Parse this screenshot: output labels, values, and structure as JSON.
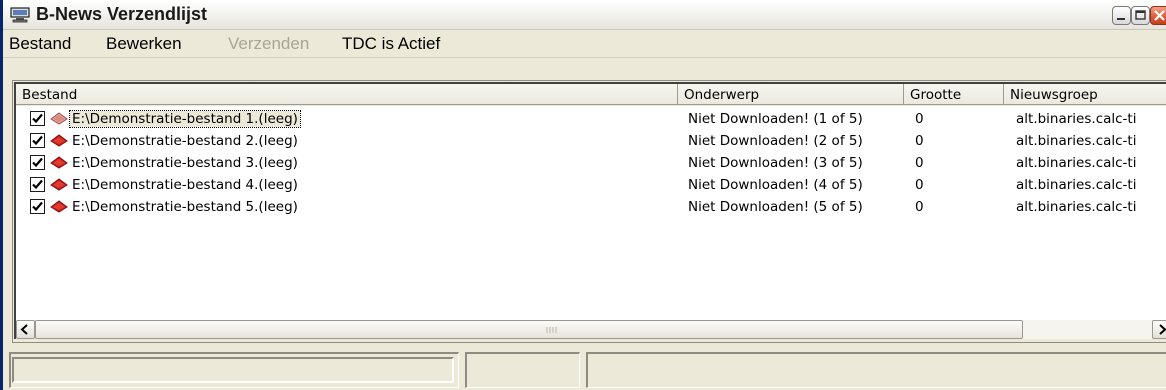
{
  "window": {
    "title": "B-News Verzendlijst",
    "app_icon": "computer-icon"
  },
  "menu": {
    "items": [
      {
        "label": "Bestand",
        "enabled": true
      },
      {
        "label": "Bewerken",
        "enabled": true
      },
      {
        "label": "Verzenden",
        "enabled": false
      },
      {
        "label": "TDC is Actief",
        "enabled": true
      }
    ]
  },
  "list": {
    "columns": [
      "Bestand",
      "Onderwerp",
      "Grootte",
      "Nieuwsgroep"
    ],
    "rows": [
      {
        "checked": true,
        "icon": "book-icon",
        "file": "E:\\Demonstratie-bestand 1.(leeg)",
        "subject": "Niet Downloaden! (1 of 5)",
        "size": "0",
        "newsgroup": "alt.binaries.calc-ti",
        "selected": true
      },
      {
        "checked": true,
        "icon": "book-icon",
        "file": "E:\\Demonstratie-bestand 2.(leeg)",
        "subject": "Niet Downloaden! (2 of 5)",
        "size": "0",
        "newsgroup": "alt.binaries.calc-ti",
        "selected": false
      },
      {
        "checked": true,
        "icon": "book-icon",
        "file": "E:\\Demonstratie-bestand 3.(leeg)",
        "subject": "Niet Downloaden! (3 of 5)",
        "size": "0",
        "newsgroup": "alt.binaries.calc-ti",
        "selected": false
      },
      {
        "checked": true,
        "icon": "book-icon",
        "file": "E:\\Demonstratie-bestand 4.(leeg)",
        "subject": "Niet Downloaden! (4 of 5)",
        "size": "0",
        "newsgroup": "alt.binaries.calc-ti",
        "selected": false
      },
      {
        "checked": true,
        "icon": "book-icon",
        "file": "E:\\Demonstratie-bestand 5.(leeg)",
        "subject": "Niet Downloaden! (5 of 5)",
        "size": "0",
        "newsgroup": "alt.binaries.calc-ti",
        "selected": false
      }
    ]
  },
  "colors": {
    "selected_bg": "#ece9d8",
    "close_button": "#d85a34",
    "book_red": "#cc1f1f"
  }
}
